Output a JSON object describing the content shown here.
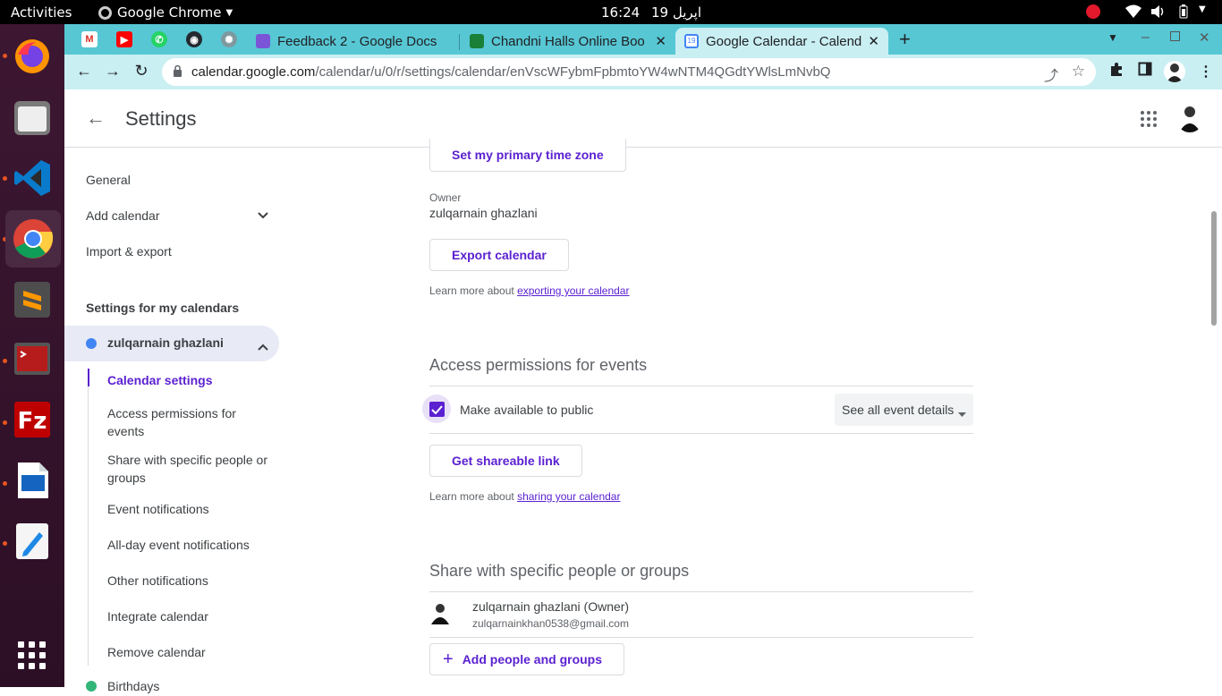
{
  "system": {
    "activities": "Activities",
    "app_menu": "Google Chrome",
    "clock_time": "16:24",
    "clock_date": "19 اپریل"
  },
  "browser": {
    "tabs": [
      {
        "label": "Feedback 2 - Google Docs",
        "color": "#7b55d8"
      },
      {
        "label": "Chandni Halls Online Boo",
        "color": "#1a7f37"
      },
      {
        "label": "Google Calendar - Calend",
        "color": "#4285f4",
        "active": true
      }
    ],
    "url_domain": "calendar.google.com",
    "url_path": "/calendar/u/0/r/settings/calendar/enVscWFybmFpbmtoYW4wNTM4QGdtYWlsLmNvbQ"
  },
  "app": {
    "title": "Settings"
  },
  "sidebar": {
    "general": "General",
    "add_calendar": "Add calendar",
    "import_export": "Import & export",
    "my_calendars_heading": "Settings for my calendars",
    "calendar_name": "zulqarnain ghazlani",
    "sub_items": [
      "Calendar settings",
      "Access permissions for events",
      "Share with specific people or groups",
      "Event notifications",
      "All-day event notifications",
      "Other notifications",
      "Integrate calendar",
      "Remove calendar"
    ],
    "birthdays": "Birthdays"
  },
  "main": {
    "set_timezone_button": "Set my primary time zone",
    "owner_label": "Owner",
    "owner_name": "zulqarnain ghazlani",
    "export_button": "Export calendar",
    "learn_more_prefix": "Learn more about ",
    "export_link": "exporting your calendar",
    "access_title": "Access permissions for events",
    "public_checkbox_label": "Make available to public",
    "public_checked": true,
    "visibility_select": "See all event details",
    "shareable_link_button": "Get shareable link",
    "sharing_link": "sharing your calendar",
    "share_title": "Share with specific people or groups",
    "person_name": "zulqarnain ghazlani (Owner)",
    "person_email": "zulqarnainkhan0538@gmail.com",
    "add_people_button": "Add people and groups"
  },
  "colors": {
    "accent": "#5b21d1",
    "chrome_frame": "#57c7d4",
    "calendar_dot": "#4285f4",
    "birthday_dot": "#33b679"
  }
}
